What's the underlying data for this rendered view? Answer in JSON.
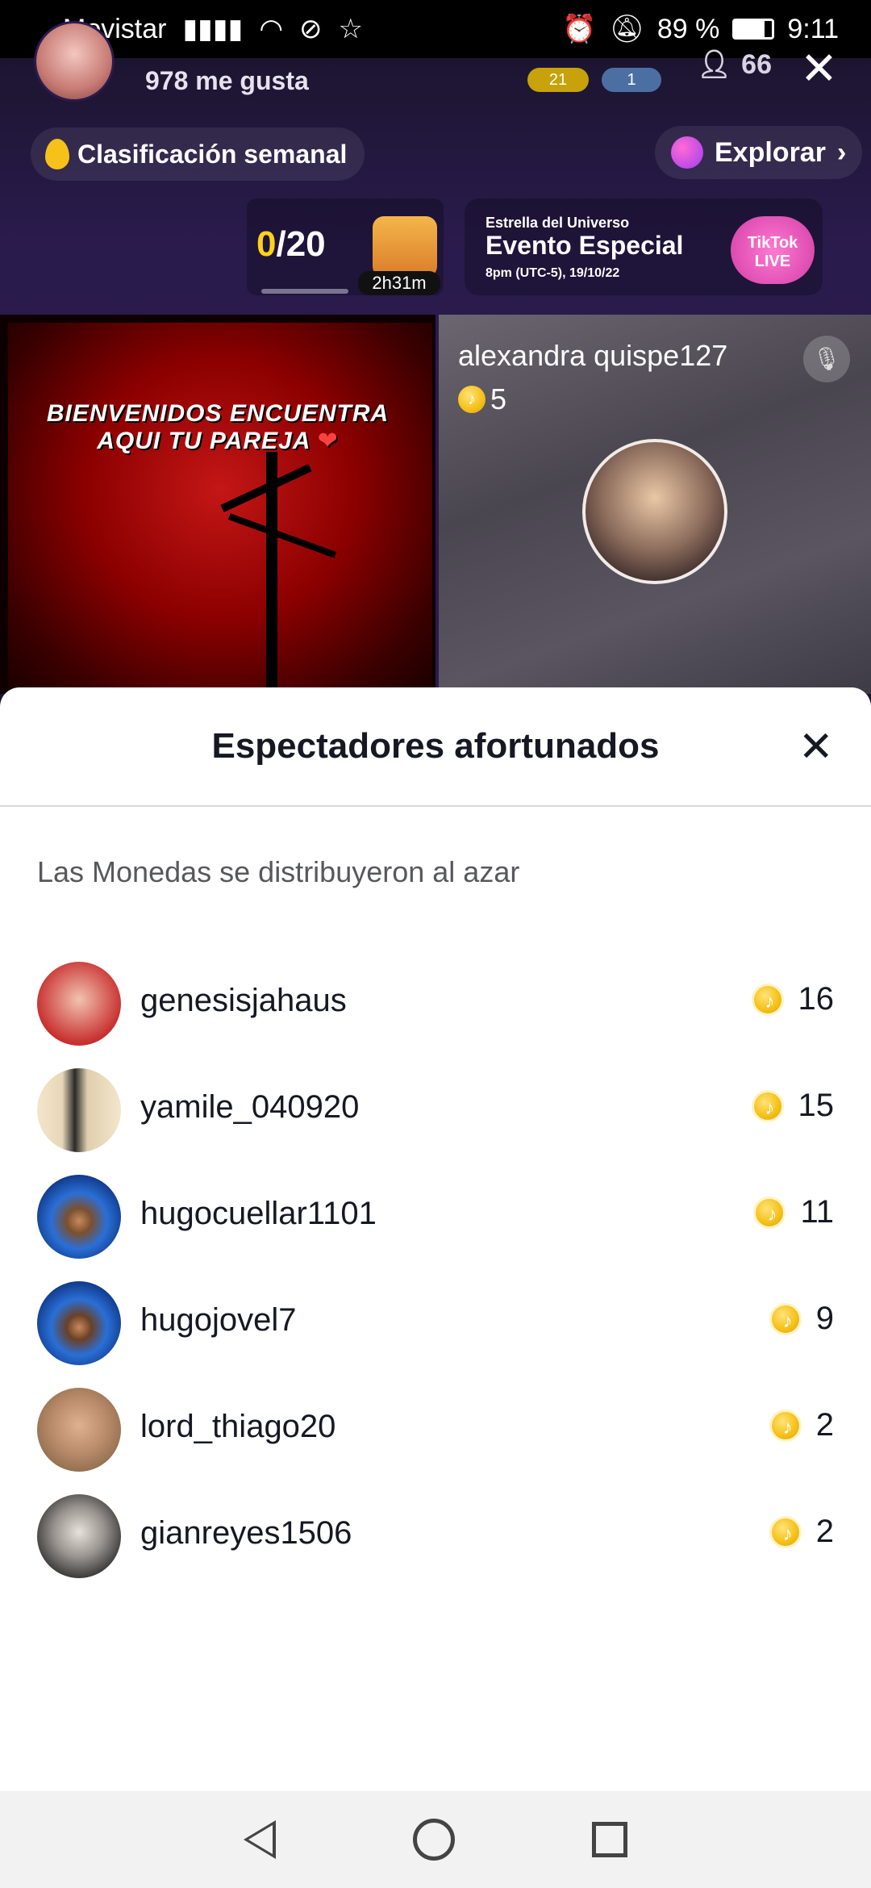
{
  "status_bar": {
    "carrier": "Movistar",
    "battery": "89 %",
    "time": "9:11"
  },
  "live": {
    "host_likes": "978 me gusta",
    "badge_gold": "21",
    "badge_blue": "1",
    "viewer_count": "66",
    "weekly_ranking_label": "Clasificación semanal",
    "explore_label": "Explorar",
    "goal_current": "0",
    "goal_total": "/20",
    "timer": "2h31m",
    "event": {
      "small": "Estrella del Universo",
      "title": "Evento Especial",
      "date": "8pm (UTC-5), 19/10/22",
      "badge": "TikTok LIVE"
    },
    "left_tile_text": "BIENVENIDOS ENCUENTRA AQUI TU PAREJA",
    "guest_name": "alexandra quispe127",
    "guest_coins": "5"
  },
  "sheet": {
    "title": "Espectadores afortunados",
    "subtitle": "Las Monedas se distribuyeron al azar",
    "viewers": [
      {
        "name": "genesisjahaus",
        "coins": "16",
        "avatar_color": "#c8302f"
      },
      {
        "name": "yamile_040920",
        "coins": "15",
        "avatar_color": "#e8d6b8"
      },
      {
        "name": "hugocuellar1101",
        "coins": "11",
        "avatar_color": "#2a6fd6"
      },
      {
        "name": "hugojovel7",
        "coins": "9",
        "avatar_color": "#2a6fd6"
      },
      {
        "name": "lord_thiago20",
        "coins": "2",
        "avatar_color": "#b98b6a"
      },
      {
        "name": "gianreyes1506",
        "coins": "2",
        "avatar_color": "#3a3a3a"
      }
    ]
  },
  "colors": {
    "coin": "#f6c21a",
    "sheet_bg": "#ffffff",
    "text_primary": "#161823"
  }
}
